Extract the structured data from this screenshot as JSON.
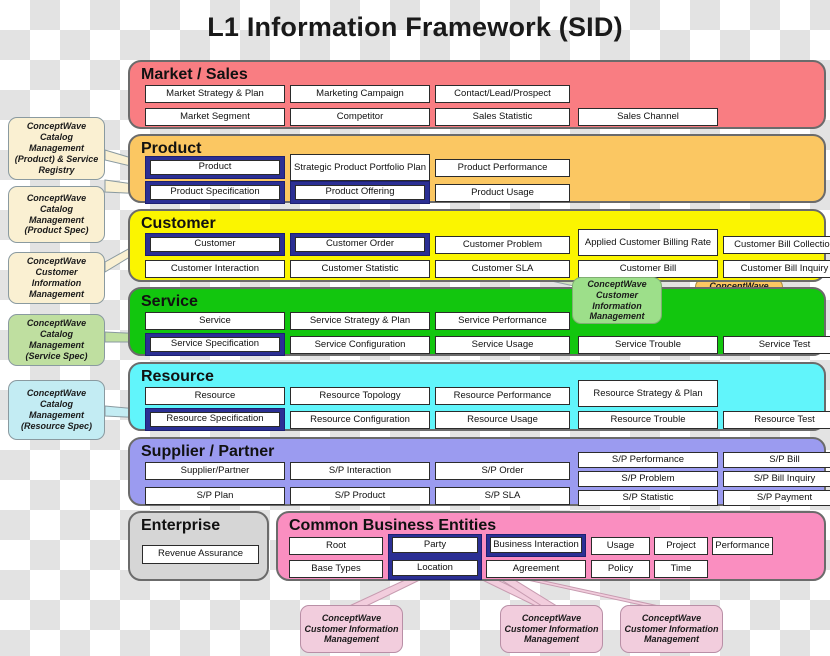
{
  "page": {
    "title": "L1 Information Framework (SID)"
  },
  "colors": {
    "market": "#f97d82",
    "product": "#fbc762",
    "customer": "#fbf500",
    "service": "#12c60e",
    "resource": "#61f5fb",
    "supplier": "#9b9bf0",
    "enterprise": "#d6d6d6",
    "common": "#fa8ec0",
    "highlight": "#2b2f94"
  },
  "bands": [
    {
      "id": "market",
      "title": "Market / Sales",
      "entities": [
        {
          "label": "Market Strategy & Plan",
          "highlight": false
        },
        {
          "label": "Marketing Campaign",
          "highlight": false
        },
        {
          "label": "Contact/Lead/Prospect",
          "highlight": false
        },
        {
          "label": "Market Segment",
          "highlight": false
        },
        {
          "label": "Competitor",
          "highlight": false
        },
        {
          "label": "Sales Statistic",
          "highlight": false
        },
        {
          "label": "Sales Channel",
          "highlight": false
        }
      ]
    },
    {
      "id": "product",
      "title": "Product",
      "entities": [
        {
          "label": "Product",
          "highlight": true
        },
        {
          "label": "Strategic Product Portfolio Plan",
          "highlight": false
        },
        {
          "label": "Product Performance",
          "highlight": false
        },
        {
          "label": "Product Specification",
          "highlight": true
        },
        {
          "label": "Product Offering",
          "highlight": true
        },
        {
          "label": "Product Usage",
          "highlight": false
        }
      ]
    },
    {
      "id": "customer",
      "title": "Customer",
      "entities": [
        {
          "label": "Customer",
          "highlight": true
        },
        {
          "label": "Customer Order",
          "highlight": true
        },
        {
          "label": "Customer Problem",
          "highlight": false
        },
        {
          "label": "Applied Customer Billing Rate",
          "highlight": false
        },
        {
          "label": "Customer Bill Collection",
          "highlight": false
        },
        {
          "label": "Customer Interaction",
          "highlight": false
        },
        {
          "label": "Customer Statistic",
          "highlight": false
        },
        {
          "label": "Customer SLA",
          "highlight": false
        },
        {
          "label": "Customer Bill",
          "highlight": false
        },
        {
          "label": "Customer Bill Inquiry",
          "highlight": false
        }
      ]
    },
    {
      "id": "service",
      "title": "Service",
      "entities": [
        {
          "label": "Service",
          "highlight": false
        },
        {
          "label": "Service Strategy & Plan",
          "highlight": false
        },
        {
          "label": "Service Performance",
          "highlight": false
        },
        {
          "label": "Service Specification",
          "highlight": true
        },
        {
          "label": "Service Configuration",
          "highlight": false
        },
        {
          "label": "Service Usage",
          "highlight": false
        },
        {
          "label": "Service Trouble",
          "highlight": false
        },
        {
          "label": "Service Test",
          "highlight": false
        }
      ]
    },
    {
      "id": "resource",
      "title": "Resource",
      "entities": [
        {
          "label": "Resource",
          "highlight": false
        },
        {
          "label": "Resource Topology",
          "highlight": false
        },
        {
          "label": "Resource Performance",
          "highlight": false
        },
        {
          "label": "Resource Strategy & Plan",
          "highlight": false
        },
        {
          "label": "Resource Specification",
          "highlight": true
        },
        {
          "label": "Resource Configuration",
          "highlight": false
        },
        {
          "label": "Resource Usage",
          "highlight": false
        },
        {
          "label": "Resource Trouble",
          "highlight": false
        },
        {
          "label": "Resource Test",
          "highlight": false
        }
      ]
    },
    {
      "id": "supplier",
      "title": "Supplier / Partner",
      "entities": [
        {
          "label": "Supplier/Partner",
          "highlight": false
        },
        {
          "label": "S/P Interaction",
          "highlight": false
        },
        {
          "label": "S/P Order",
          "highlight": false
        },
        {
          "label": "S/P Plan",
          "highlight": false
        },
        {
          "label": "S/P Product",
          "highlight": false
        },
        {
          "label": "S/P SLA",
          "highlight": false
        },
        {
          "label": "S/P Performance",
          "highlight": false
        },
        {
          "label": "S/P Problem",
          "highlight": false
        },
        {
          "label": "S/P Statistic",
          "highlight": false
        },
        {
          "label": "S/P Bill",
          "highlight": false
        },
        {
          "label": "S/P Bill Inquiry",
          "highlight": false
        },
        {
          "label": "S/P Payment",
          "highlight": false
        }
      ]
    },
    {
      "id": "enterprise",
      "title": "Enterprise",
      "entities": [
        {
          "label": "Revenue Assurance",
          "highlight": false
        }
      ]
    },
    {
      "id": "common",
      "title": "Common Business Entities",
      "entities": [
        {
          "label": "Root",
          "highlight": false
        },
        {
          "label": "Party",
          "highlight": true
        },
        {
          "label": "Business Interaction",
          "highlight": true
        },
        {
          "label": "Usage",
          "highlight": false
        },
        {
          "label": "Project",
          "highlight": false
        },
        {
          "label": "Performance",
          "highlight": false
        },
        {
          "label": "Base Types",
          "highlight": false
        },
        {
          "label": "Location",
          "highlight": true
        },
        {
          "label": "Agreement",
          "highlight": false
        },
        {
          "label": "Policy",
          "highlight": false
        },
        {
          "label": "Time",
          "highlight": false
        }
      ]
    }
  ],
  "callouts": [
    {
      "id": "cw-catalog-product",
      "style": "cream",
      "text": "ConceptWave Catalog Management (Product) & Service Registry"
    },
    {
      "id": "cw-catalog-product-spec",
      "style": "cream",
      "text": "ConceptWave Catalog Management (Product Spec)"
    },
    {
      "id": "cw-customer-info-left",
      "style": "cream",
      "text": "ConceptWave Customer Information Management"
    },
    {
      "id": "cw-catalog-service-spec",
      "style": "green",
      "text": "ConceptWave Catalog Management (Service Spec)"
    },
    {
      "id": "cw-catalog-resource-spec",
      "style": "cyan",
      "text": "ConceptWave Catalog Management (Resource Spec)"
    },
    {
      "id": "cw-catalog-offer",
      "style": "offer",
      "text": "ConceptWave Catalog Management (Offer)"
    },
    {
      "id": "cw-customer-info-center",
      "style": "greensemi",
      "text": "ConceptWave Customer Information Management"
    },
    {
      "id": "cw-customer-info-bottom-1",
      "style": "pink",
      "text": "ConceptWave Customer Information Management"
    },
    {
      "id": "cw-customer-info-bottom-2",
      "style": "pink",
      "text": "ConceptWave Customer Information Management"
    },
    {
      "id": "cw-customer-info-bottom-3",
      "style": "pink",
      "text": "ConceptWave Customer Information Management"
    }
  ]
}
